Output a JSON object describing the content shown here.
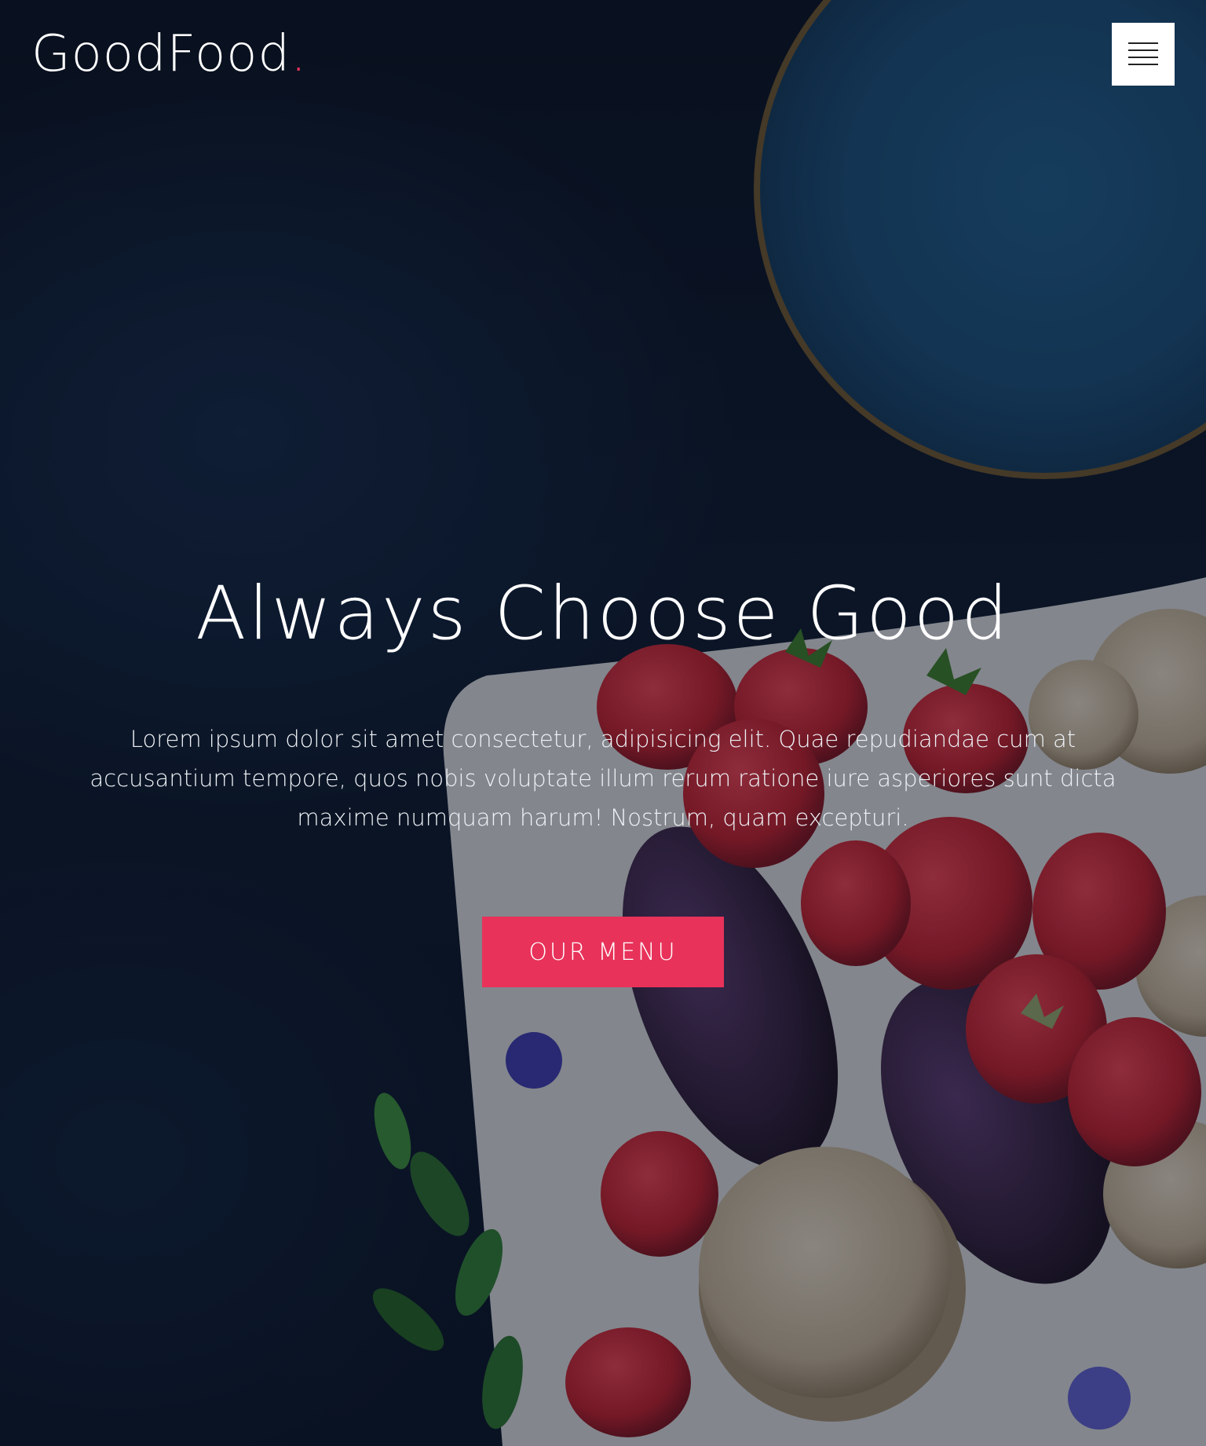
{
  "brand": {
    "name": "GoodFood",
    "dot": ".",
    "accent_color": "#e8325a"
  },
  "nav": {
    "menu_icon": "hamburger-menu-icon"
  },
  "hero": {
    "title": "Always Choose Good",
    "description": "Lorem ipsum dolor sit amet consectetur, adipisicing elit. Quae repudiandae cum at accusantium tempore, quos nobis voluptate illum rerum ratione iure asperiores sunt dicta maxime numquam harum! Nostrum, quam excepturi.",
    "cta_label": "OUR MENU",
    "background_image": "food-board-with-strawberries-blueberries-crackers-and-blue-plate"
  }
}
